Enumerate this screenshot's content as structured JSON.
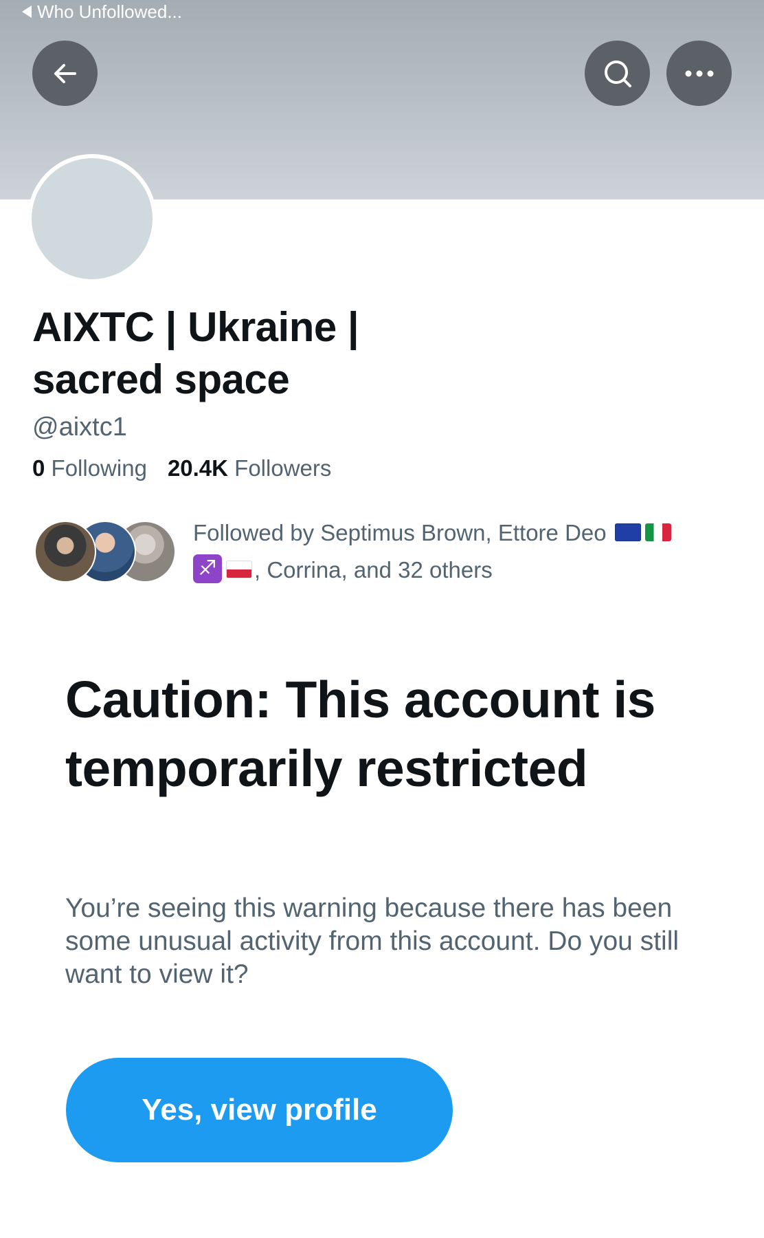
{
  "status_bar": {
    "back_app_label": "Who Unfollowed..."
  },
  "header": {
    "back_icon": "arrow-left-icon",
    "search_icon": "search-icon",
    "more_icon": "more-horizontal-icon"
  },
  "profile": {
    "display_name": "AIXTC | Ukraine | sacred space",
    "handle": "@aixtc1",
    "following_count": "0",
    "following_label": "Following",
    "followers_count": "20.4K",
    "followers_label": "Followers"
  },
  "followed_by": {
    "prefix": "Followed by Septimus Brown, Ettore Deo",
    "suffix": ", Corrina, and 32 others",
    "emoji_icons": [
      "flag-eu-icon",
      "flag-italy-icon",
      "sagittarius-icon",
      "flag-poland-icon"
    ]
  },
  "warning": {
    "title": "Caution: This account is temporarily restricted",
    "body": "You’re seeing this warning because there has been some unusual activity from this account. Do you still want to view it?",
    "button_label": "Yes, view profile"
  },
  "colors": {
    "accent": "#1d9bf0",
    "text_primary": "#0f1419",
    "text_secondary": "#536471",
    "header_button": "#5b6166"
  }
}
